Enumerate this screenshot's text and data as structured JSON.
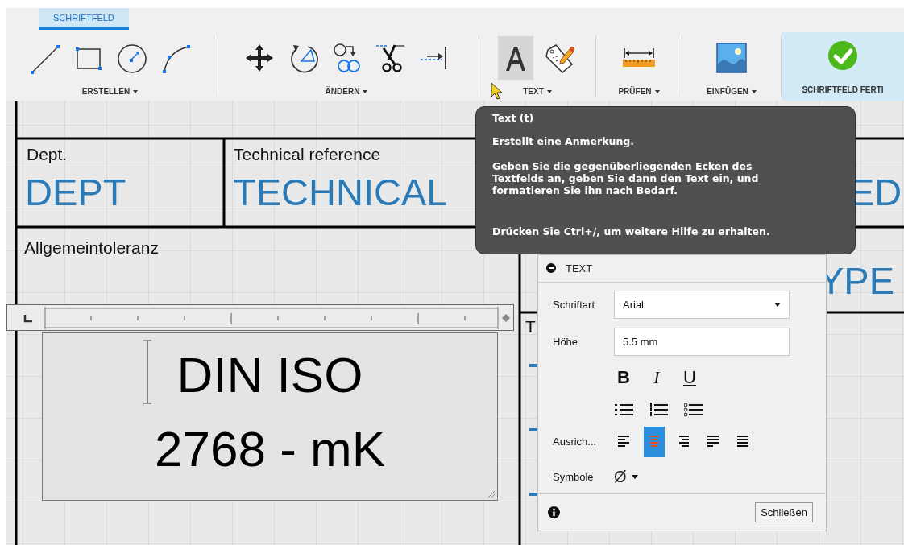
{
  "ribbon": {
    "tab": {
      "label": "SCHRIFTFELD",
      "selected": true
    },
    "groups": [
      {
        "label": "ERSTELLEN",
        "menu": true,
        "tools": [
          {
            "kind": "line",
            "active": false
          },
          {
            "kind": "rectangle",
            "active": false
          },
          {
            "kind": "circle",
            "active": false
          },
          {
            "kind": "arc",
            "active": false
          }
        ]
      },
      {
        "label": "ÄNDERN",
        "menu": true,
        "tools": [
          {
            "kind": "move",
            "active": false
          },
          {
            "kind": "rotate",
            "active": false
          },
          {
            "kind": "offset",
            "active": false
          },
          {
            "kind": "trim",
            "active": false
          },
          {
            "kind": "extend",
            "active": false
          }
        ]
      },
      {
        "label": "TEXT",
        "menu": true,
        "tools": [
          {
            "kind": "text",
            "active": true
          },
          {
            "kind": "note",
            "active": false
          }
        ]
      },
      {
        "label": "PRÜFEN",
        "menu": true,
        "tools": [
          {
            "kind": "measure",
            "active": false
          }
        ]
      },
      {
        "label": "EINFÜGEN",
        "menu": true,
        "tools": [
          {
            "kind": "image",
            "active": false
          }
        ]
      },
      {
        "label": "SCHRIFTFELD FERTI",
        "menu": false,
        "tools": [
          {
            "kind": "finish",
            "active": false
          }
        ]
      }
    ]
  },
  "title_block": {
    "cells": [
      {
        "label": "Dept.",
        "value": "DEPT"
      },
      {
        "label": "Technical reference",
        "value": "TECHNICAL"
      },
      {
        "value": "ED"
      },
      {
        "label": "Allgemeintoleranz"
      },
      {
        "value": "YPE"
      },
      {
        "label": "T"
      }
    ]
  },
  "text_editor": {
    "lines": [
      "DIN ISO",
      "2768 - mK"
    ]
  },
  "tooltip": {
    "title": "Text (t)",
    "paragraphs": [
      "Erstellt eine Anmerkung.",
      "Geben Sie die gegenüberliegenden Ecken des Textfelds an, geben Sie dann den Text ein, und formatieren Sie ihn nach Bedarf.",
      "Drücken Sie Ctrl+/, um weitere Hilfe zu erhalten."
    ]
  },
  "text_panel": {
    "title": "TEXT",
    "font": {
      "label": "Schriftart",
      "value": "Arial"
    },
    "height": {
      "label": "Höhe",
      "value": "5.5 mm"
    },
    "styles": [
      {
        "kind": "bold",
        "label": "B"
      },
      {
        "kind": "italic",
        "label": "I"
      },
      {
        "kind": "underline",
        "label": "U"
      }
    ],
    "lists": [
      {
        "kind": "bullets"
      },
      {
        "kind": "numbers"
      },
      {
        "kind": "letters"
      }
    ],
    "alignment": {
      "label": "Ausrich...",
      "options": [
        {
          "kind": "left",
          "selected": false
        },
        {
          "kind": "center",
          "selected": true
        },
        {
          "kind": "right",
          "selected": false
        },
        {
          "kind": "justify",
          "selected": false
        },
        {
          "kind": "distributed",
          "selected": false
        }
      ]
    },
    "symbols": {
      "label": "Symbole",
      "value": "Ø"
    },
    "close_button": "Schließen"
  }
}
